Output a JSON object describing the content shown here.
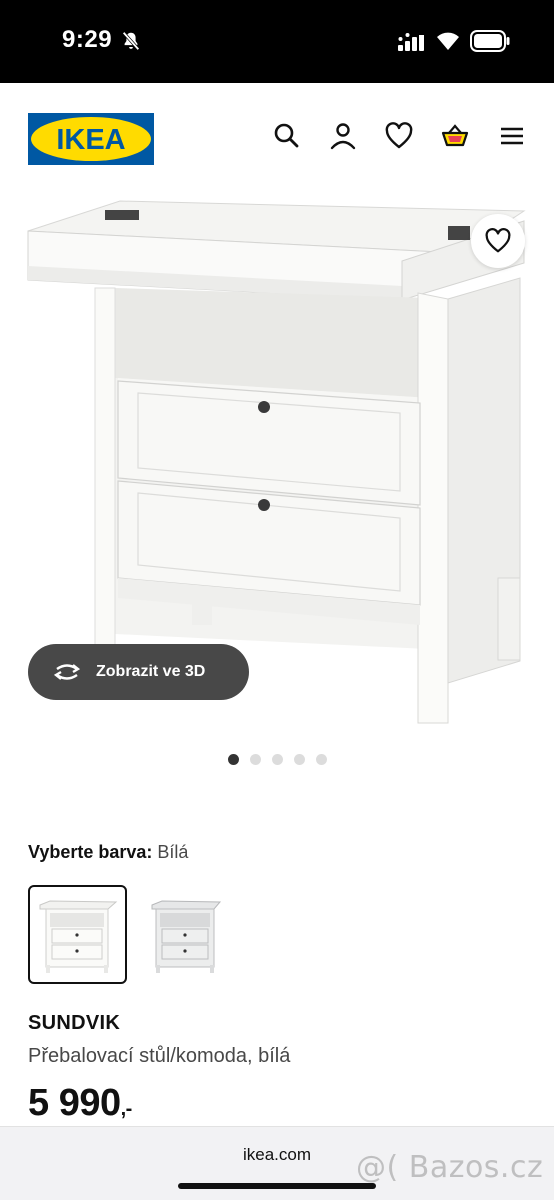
{
  "status_bar": {
    "time": "9:29"
  },
  "header": {
    "logo_text": "IKEA",
    "icons": [
      "search-icon",
      "user-icon",
      "heart-icon",
      "cart-icon",
      "menu-icon"
    ]
  },
  "product_view": {
    "view_3d_label": "Zobrazit ve 3D",
    "image_count": 5,
    "active_image": 1
  },
  "color_select": {
    "label": "Vyberte barva:",
    "selected_value": "Bílá",
    "options": [
      "white",
      "grey"
    ]
  },
  "product": {
    "name": "SUNDVIK",
    "description": "Přebalovací stůl/komoda, bílá",
    "price": "5 990",
    "price_suffix": ",-"
  },
  "browser": {
    "url": "ikea.com"
  },
  "watermark": "@( Bazos.cz",
  "colors": {
    "ikea_blue": "#0058a3",
    "ikea_yellow": "#ffdb00",
    "button_dark": "#484848"
  }
}
